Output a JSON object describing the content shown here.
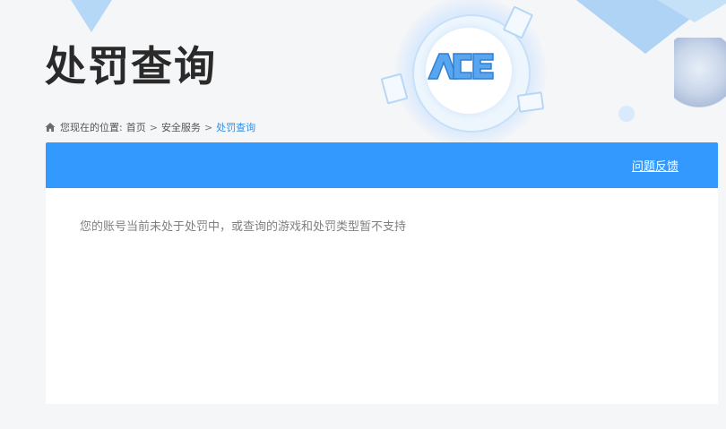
{
  "page": {
    "title": "处罚查询"
  },
  "banner": {
    "logo_icon": "ace-logo-icon"
  },
  "breadcrumb": {
    "icon": "home-icon",
    "prefix": "您现在的位置:",
    "items": [
      "首页",
      "安全服务",
      "处罚查询"
    ],
    "separator": ">"
  },
  "panel": {
    "feedback_label": "问题反馈",
    "message": "您的账号当前未处于处罚中，或查询的游戏和处罚类型暂不支持"
  },
  "colors": {
    "accent": "#3399ff",
    "breadcrumb_current": "#2f8fe6",
    "message_text": "#808080",
    "title_text": "#2a2a2a"
  }
}
